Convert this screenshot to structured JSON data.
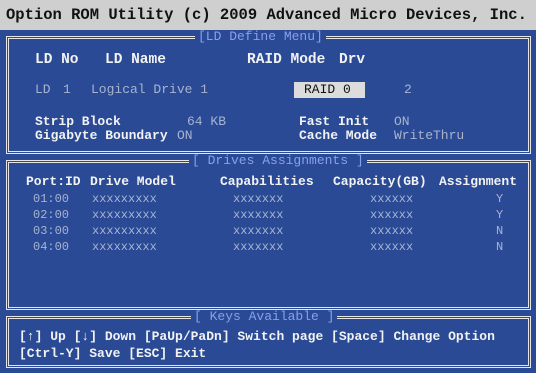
{
  "title": "Option ROM Utility (c) 2009 Advanced Micro Devices, Inc.",
  "ld_panel": {
    "title": "[LD Define Menu]",
    "headers": {
      "ld_no": "LD No",
      "ld_name": "LD Name",
      "raid_mode": "RAID Mode",
      "drv": "Drv"
    },
    "ld_label": "LD",
    "ld_number": "1",
    "ld_name": "Logical Drive 1",
    "raid_mode": "RAID 0",
    "drv": "2",
    "strip_block_label": "Strip Block",
    "strip_block_value": "64 KB",
    "fast_init_label": "Fast Init",
    "fast_init_value": "ON",
    "gigabyte_boundary_label": "Gigabyte Boundary",
    "gigabyte_boundary_value": "ON",
    "cache_mode_label": "Cache Mode",
    "cache_mode_value": "WriteThru"
  },
  "drives_panel": {
    "title": "[ Drives Assignments ]",
    "columns": [
      "Port:ID",
      "Drive Model",
      "Capabilities",
      "Capacity(GB)",
      "Assignment"
    ],
    "rows": [
      [
        "01:00",
        "xxxxxxxxx",
        "xxxxxxx",
        "xxxxxx",
        "Y"
      ],
      [
        "02:00",
        "xxxxxxxxx",
        "xxxxxxx",
        "xxxxxx",
        "Y"
      ],
      [
        "03:00",
        "xxxxxxxxx",
        "xxxxxxx",
        "xxxxxx",
        "N"
      ],
      [
        "04:00",
        "xxxxxxxxx",
        "xxxxxxx",
        "xxxxxx",
        "N"
      ]
    ]
  },
  "keys_panel": {
    "title": "[ Keys Available ]",
    "line1": "[↑] Up  [↓] Down  [PaUp/PaDn] Switch page  [Space] Change Option",
    "line2": "[Ctrl-Y] Save  [ESC] Exit"
  },
  "colors": {
    "background": "#2a4a95",
    "title_bar": "#cfcfcf",
    "panel_title": "#8aa0e8",
    "text_bright": "#f2f2f2",
    "text_dim": "#a9b3cf",
    "selected_field": "#dcdcdc"
  }
}
